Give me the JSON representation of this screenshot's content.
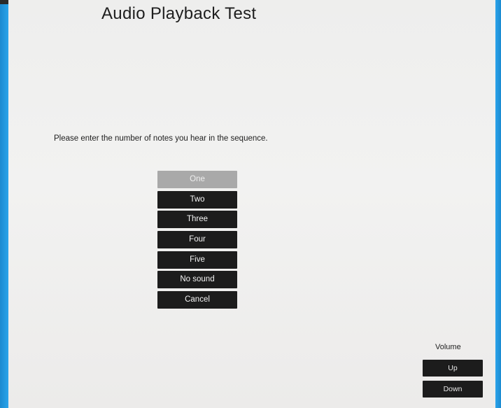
{
  "title": "Audio Playback Test",
  "prompt": "Please enter the number of notes you hear in the sequence.",
  "choices": [
    {
      "label": "One",
      "selected": true
    },
    {
      "label": "Two",
      "selected": false
    },
    {
      "label": "Three",
      "selected": false
    },
    {
      "label": "Four",
      "selected": false
    },
    {
      "label": "Five",
      "selected": false
    },
    {
      "label": "No sound",
      "selected": false
    },
    {
      "label": "Cancel",
      "selected": false
    }
  ],
  "volume": {
    "label": "Volume",
    "up_label": "Up",
    "down_label": "Down"
  },
  "colors": {
    "frame": "#1a8fd6",
    "button_bg": "#1c1c1c",
    "button_selected_bg": "#a9a9a9",
    "screen_bg": "#f0f0ef"
  }
}
